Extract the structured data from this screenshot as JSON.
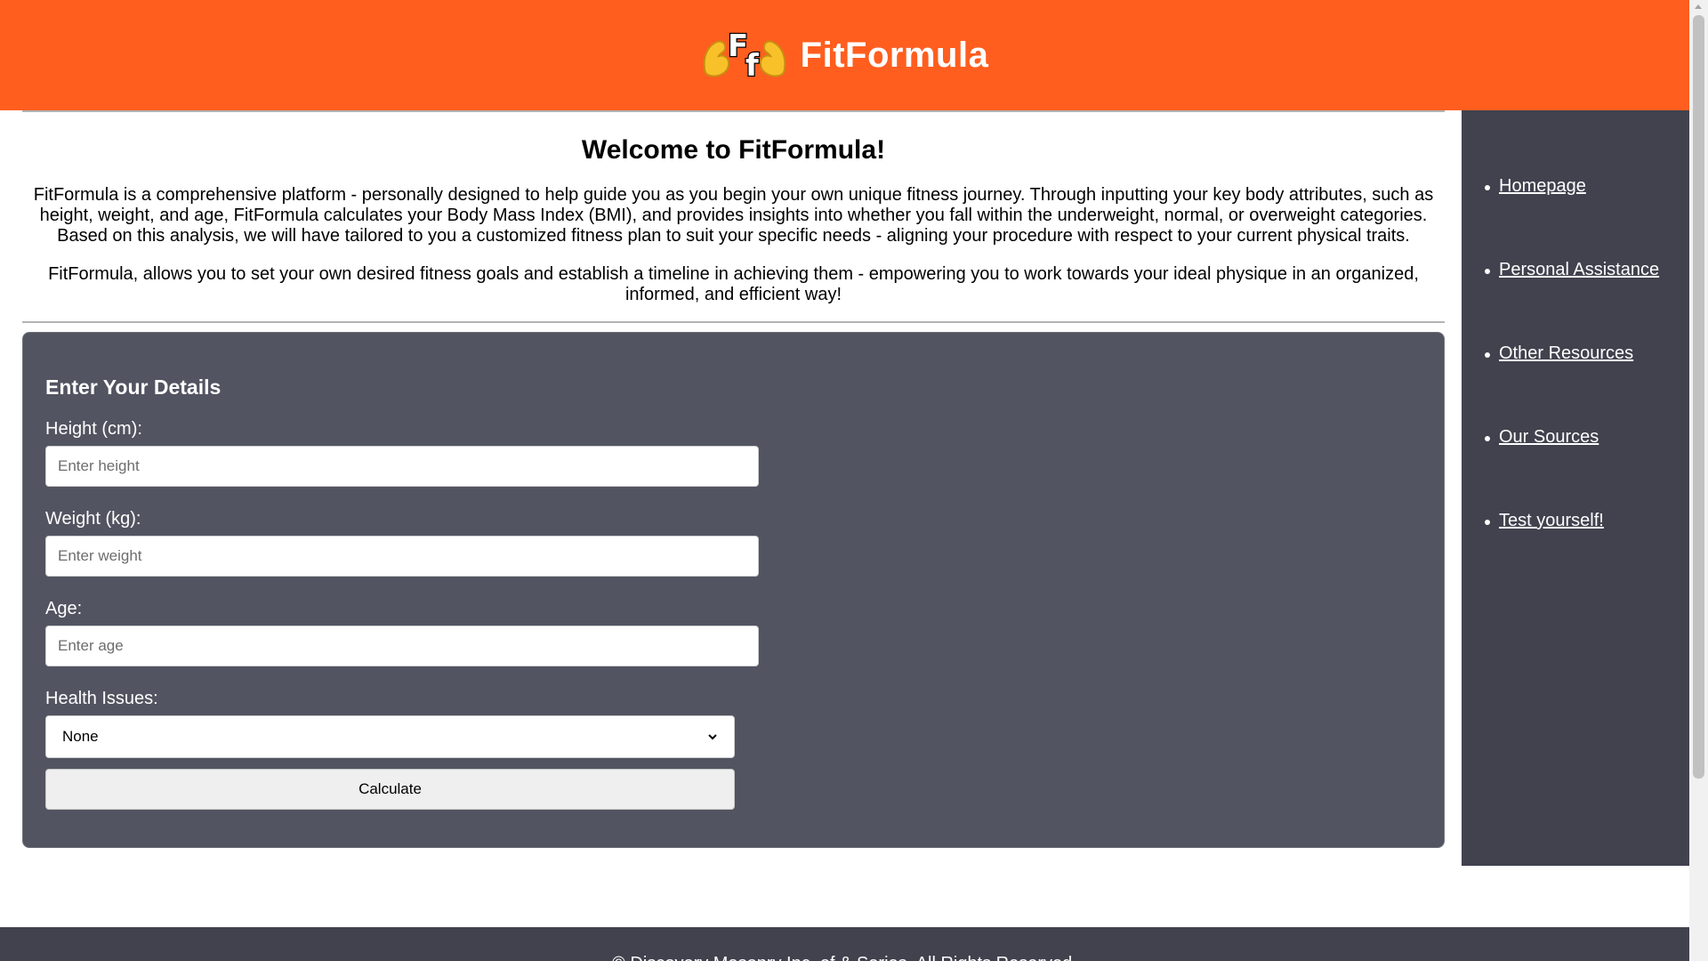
{
  "header": {
    "brand_name": "FitFormula",
    "logo": {
      "letters": "Ff",
      "icon": "flexing-arms-logo"
    },
    "background_color": "#ff5e1f"
  },
  "intro": {
    "title": "Welcome to FitFormula!",
    "paragraphs": [
      "FitFormula is a comprehensive platform - personally designed to help guide you as you begin your own unique fitness journey. Through inputting your key body attributes, such as height, weight, and age, FitFormula calculates your Body Mass Index (BMI), and provides insights into whether you fall within the underweight, normal, or overweight categories. Based on this analysis, we will have tailored to you a customized fitness plan to suit your specific needs - aligning your procedure with respect to your current physical traits.",
      "FitFormula, allows you to set your own desired fitness goals and establish a timeline in achieving them - empowering you to work towards your ideal physique in an organized, informed, and efficient way!"
    ]
  },
  "form": {
    "title": "Enter Your Details",
    "height": {
      "label": "Height (cm):",
      "value": "",
      "placeholder": "Enter height"
    },
    "weight": {
      "label": "Weight (kg):",
      "value": "",
      "placeholder": "Enter weight"
    },
    "age": {
      "label": "Age:",
      "value": "",
      "placeholder": "Enter age"
    },
    "health_issues": {
      "label": "Health Issues:",
      "selected": "None"
    },
    "calculate_label": "Calculate",
    "panel_color": "#525461"
  },
  "sidebar": {
    "items": [
      {
        "label": "Homepage"
      },
      {
        "label": "Personal Assistance"
      },
      {
        "label": "Other Resources"
      },
      {
        "label": "Our Sources"
      },
      {
        "label": "Test yourself!"
      }
    ],
    "background_color": "#41424e"
  },
  "footer": {
    "text": "© Discovery Masonry Inc. of & Series. All Rights Reserved."
  }
}
